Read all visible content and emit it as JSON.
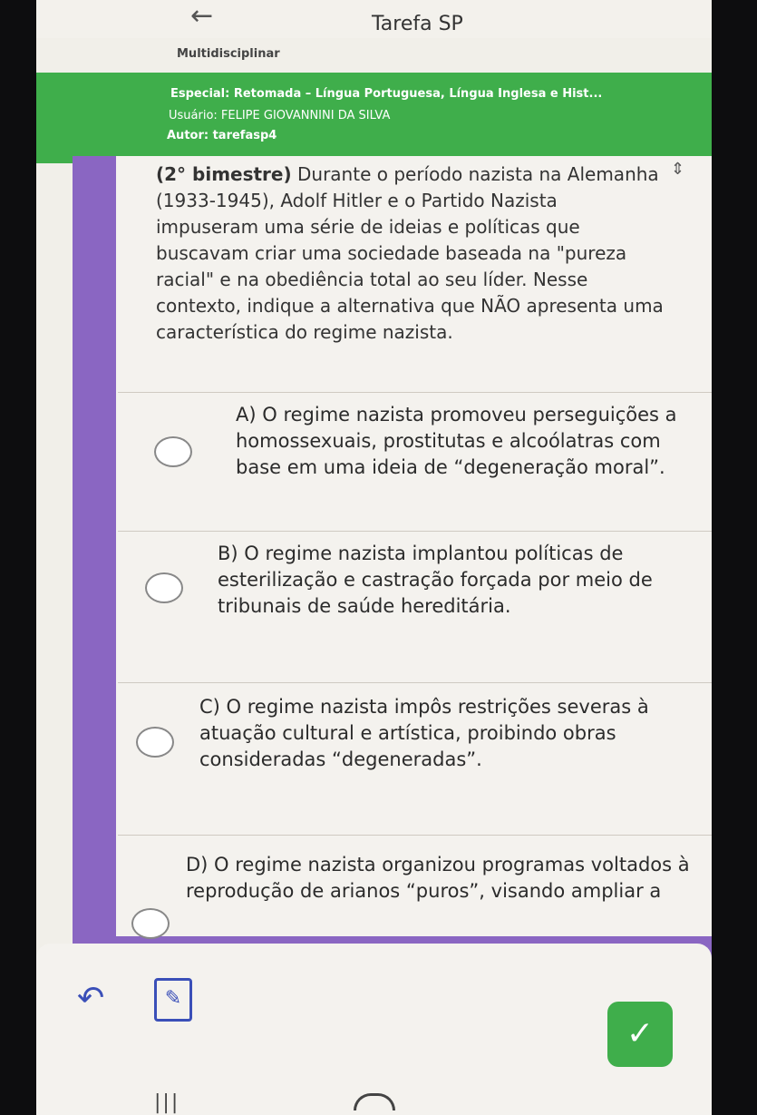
{
  "app": {
    "title": "Tarefa SP"
  },
  "subject": "Multidisciplinar",
  "header": {
    "course": "Especial: Retomada – Língua Portuguesa, Língua Inglesa e Hist...",
    "user": "Usuário: FELIPE GIOVANNINI DA SILVA",
    "author": "Autor: tarefasp4"
  },
  "question": {
    "prefix": "(2° bimestre)",
    "text": "Durante o período nazista na Alemanha (1933-1945), Adolf Hitler e o Partido Nazista impuseram uma série de ideias e políticas que buscavam criar uma sociedade baseada na \"pureza racial\" e na obediência total ao seu líder. Nesse contexto, indique a alternativa que NÃO apresenta uma característica do regime nazista."
  },
  "options": [
    {
      "text": "A) O regime nazista promoveu perseguições a homossexuais, prostitutas e alcoólatras com base em uma ideia de “degeneração moral”."
    },
    {
      "text": "B) O regime nazista implantou políticas de esterilização e castração forçada por meio de tribunais de saúde hereditária."
    },
    {
      "text": "C) O regime nazista impôs restrições severas à atuação cultural e artística, proibindo obras consideradas “degeneradas”."
    },
    {
      "text": "D) O regime nazista organizou programas voltados à reprodução de arianos “puros”, visando ampliar a"
    }
  ],
  "icons": {
    "back": "back-arrow-icon",
    "expand": "expand-icon",
    "notes": "notes-icon",
    "submit": "check-icon"
  },
  "colors": {
    "header": "#3fae4b",
    "frame": "#8a66c2",
    "accent": "#3a4fb8"
  }
}
